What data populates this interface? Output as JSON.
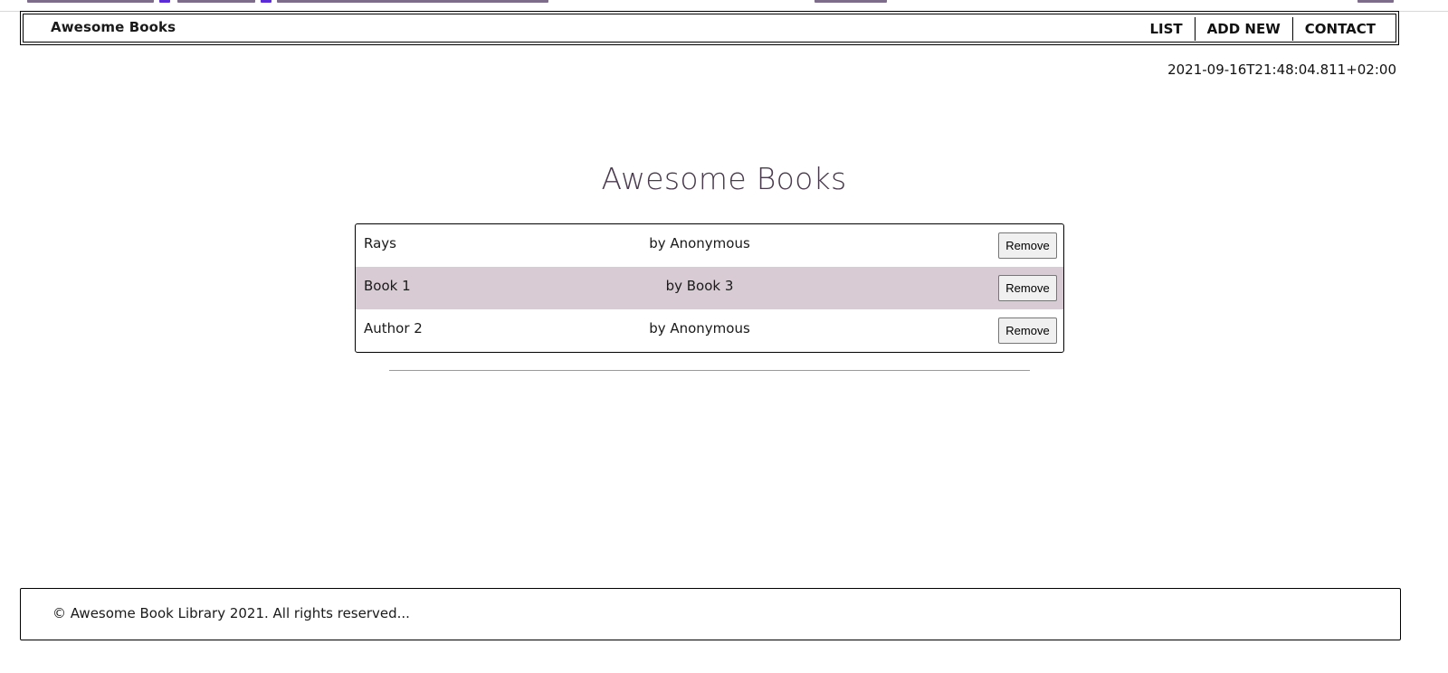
{
  "header": {
    "brand": "Awesome Books",
    "nav": [
      {
        "label": "LIST"
      },
      {
        "label": "ADD NEW"
      },
      {
        "label": "CONTACT"
      }
    ]
  },
  "datetime": "2021-09-16T21:48:04.811+02:00",
  "main": {
    "title": "Awesome Books",
    "books": [
      {
        "title": "Rays",
        "author": "by Anonymous",
        "remove_label": "Remove"
      },
      {
        "title": "Book 1",
        "author": "by Book 3",
        "remove_label": "Remove"
      },
      {
        "title": "Author 2",
        "author": "by Anonymous",
        "remove_label": "Remove"
      }
    ]
  },
  "footer": {
    "text": "© Awesome Book Library 2021. All rights reserved..."
  },
  "colors": {
    "row_alt_bg": "#d8cbd3",
    "title_color": "#4a3a4e",
    "border": "#000000"
  }
}
